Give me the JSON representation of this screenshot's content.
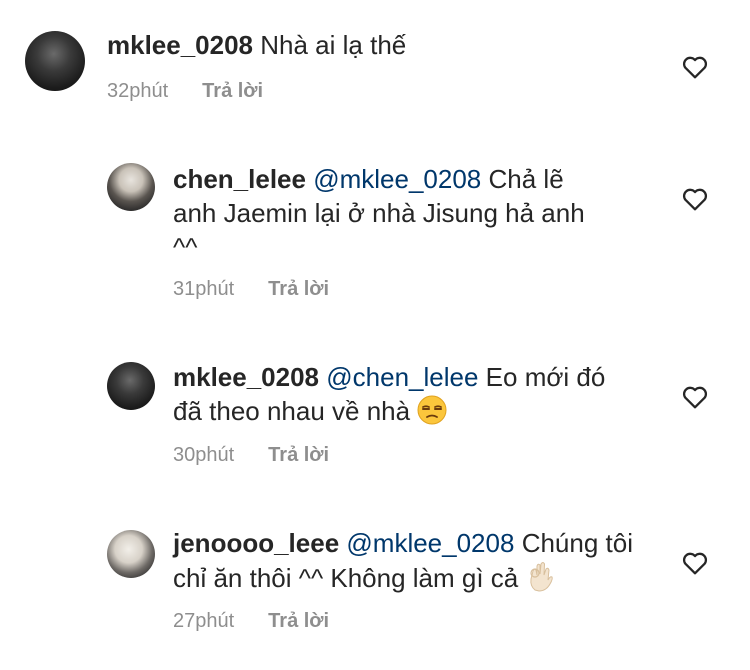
{
  "comments": [
    {
      "username": "mklee_0208",
      "mention": "",
      "text": "Nhà ai lạ thế",
      "time": "32phút",
      "reply_label": "Trả lời"
    },
    {
      "username": "chen_lelee",
      "mention": "@mklee_0208",
      "text": "Chả lẽ anh Jaemin lại ở nhà Jisung hả anh ^^",
      "time": "31phút",
      "reply_label": "Trả lời"
    },
    {
      "username": "mklee_0208",
      "mention": "@chen_lelee",
      "text": "Eo mới đó đã theo nhau về nhà",
      "emoji": "unamused-face-emoji",
      "time": "30phút",
      "reply_label": "Trả lời"
    },
    {
      "username": "jenoooo_leee",
      "mention": "@mklee_0208",
      "text": "Chúng tôi chỉ ăn thôi ^^ Không làm gì cả",
      "emoji": "ok-hand-emoji",
      "time": "27phút",
      "reply_label": "Trả lời"
    }
  ],
  "icons": {
    "like": "heart-outline-icon"
  },
  "colors": {
    "text": "#262626",
    "mention": "#00376b",
    "meta": "#8e8e8e"
  }
}
